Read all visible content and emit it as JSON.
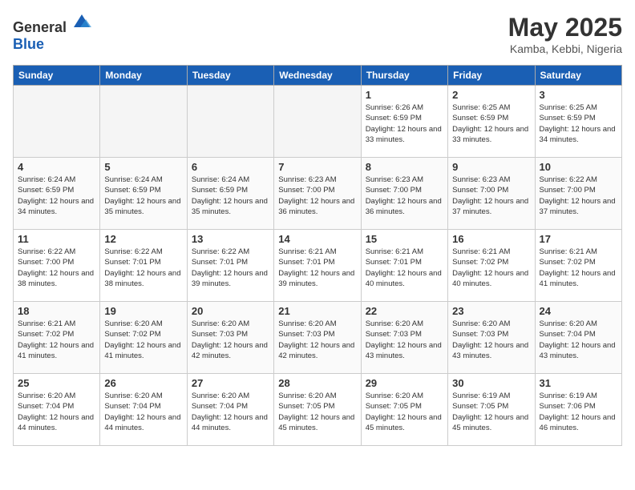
{
  "header": {
    "logo_general": "General",
    "logo_blue": "Blue",
    "title": "May 2025",
    "location": "Kamba, Kebbi, Nigeria"
  },
  "days_of_week": [
    "Sunday",
    "Monday",
    "Tuesday",
    "Wednesday",
    "Thursday",
    "Friday",
    "Saturday"
  ],
  "weeks": [
    [
      {
        "day": "",
        "empty": true
      },
      {
        "day": "",
        "empty": true
      },
      {
        "day": "",
        "empty": true
      },
      {
        "day": "",
        "empty": true
      },
      {
        "day": "1",
        "sunrise": "6:26 AM",
        "sunset": "6:59 PM",
        "daylight": "12 hours and 33 minutes."
      },
      {
        "day": "2",
        "sunrise": "6:25 AM",
        "sunset": "6:59 PM",
        "daylight": "12 hours and 33 minutes."
      },
      {
        "day": "3",
        "sunrise": "6:25 AM",
        "sunset": "6:59 PM",
        "daylight": "12 hours and 34 minutes."
      }
    ],
    [
      {
        "day": "4",
        "sunrise": "6:24 AM",
        "sunset": "6:59 PM",
        "daylight": "12 hours and 34 minutes."
      },
      {
        "day": "5",
        "sunrise": "6:24 AM",
        "sunset": "6:59 PM",
        "daylight": "12 hours and 35 minutes."
      },
      {
        "day": "6",
        "sunrise": "6:24 AM",
        "sunset": "6:59 PM",
        "daylight": "12 hours and 35 minutes."
      },
      {
        "day": "7",
        "sunrise": "6:23 AM",
        "sunset": "7:00 PM",
        "daylight": "12 hours and 36 minutes."
      },
      {
        "day": "8",
        "sunrise": "6:23 AM",
        "sunset": "7:00 PM",
        "daylight": "12 hours and 36 minutes."
      },
      {
        "day": "9",
        "sunrise": "6:23 AM",
        "sunset": "7:00 PM",
        "daylight": "12 hours and 37 minutes."
      },
      {
        "day": "10",
        "sunrise": "6:22 AM",
        "sunset": "7:00 PM",
        "daylight": "12 hours and 37 minutes."
      }
    ],
    [
      {
        "day": "11",
        "sunrise": "6:22 AM",
        "sunset": "7:00 PM",
        "daylight": "12 hours and 38 minutes."
      },
      {
        "day": "12",
        "sunrise": "6:22 AM",
        "sunset": "7:01 PM",
        "daylight": "12 hours and 38 minutes."
      },
      {
        "day": "13",
        "sunrise": "6:22 AM",
        "sunset": "7:01 PM",
        "daylight": "12 hours and 39 minutes."
      },
      {
        "day": "14",
        "sunrise": "6:21 AM",
        "sunset": "7:01 PM",
        "daylight": "12 hours and 39 minutes."
      },
      {
        "day": "15",
        "sunrise": "6:21 AM",
        "sunset": "7:01 PM",
        "daylight": "12 hours and 40 minutes."
      },
      {
        "day": "16",
        "sunrise": "6:21 AM",
        "sunset": "7:02 PM",
        "daylight": "12 hours and 40 minutes."
      },
      {
        "day": "17",
        "sunrise": "6:21 AM",
        "sunset": "7:02 PM",
        "daylight": "12 hours and 41 minutes."
      }
    ],
    [
      {
        "day": "18",
        "sunrise": "6:21 AM",
        "sunset": "7:02 PM",
        "daylight": "12 hours and 41 minutes."
      },
      {
        "day": "19",
        "sunrise": "6:20 AM",
        "sunset": "7:02 PM",
        "daylight": "12 hours and 41 minutes."
      },
      {
        "day": "20",
        "sunrise": "6:20 AM",
        "sunset": "7:03 PM",
        "daylight": "12 hours and 42 minutes."
      },
      {
        "day": "21",
        "sunrise": "6:20 AM",
        "sunset": "7:03 PM",
        "daylight": "12 hours and 42 minutes."
      },
      {
        "day": "22",
        "sunrise": "6:20 AM",
        "sunset": "7:03 PM",
        "daylight": "12 hours and 43 minutes."
      },
      {
        "day": "23",
        "sunrise": "6:20 AM",
        "sunset": "7:03 PM",
        "daylight": "12 hours and 43 minutes."
      },
      {
        "day": "24",
        "sunrise": "6:20 AM",
        "sunset": "7:04 PM",
        "daylight": "12 hours and 43 minutes."
      }
    ],
    [
      {
        "day": "25",
        "sunrise": "6:20 AM",
        "sunset": "7:04 PM",
        "daylight": "12 hours and 44 minutes."
      },
      {
        "day": "26",
        "sunrise": "6:20 AM",
        "sunset": "7:04 PM",
        "daylight": "12 hours and 44 minutes."
      },
      {
        "day": "27",
        "sunrise": "6:20 AM",
        "sunset": "7:04 PM",
        "daylight": "12 hours and 44 minutes."
      },
      {
        "day": "28",
        "sunrise": "6:20 AM",
        "sunset": "7:05 PM",
        "daylight": "12 hours and 45 minutes."
      },
      {
        "day": "29",
        "sunrise": "6:20 AM",
        "sunset": "7:05 PM",
        "daylight": "12 hours and 45 minutes."
      },
      {
        "day": "30",
        "sunrise": "6:19 AM",
        "sunset": "7:05 PM",
        "daylight": "12 hours and 45 minutes."
      },
      {
        "day": "31",
        "sunrise": "6:19 AM",
        "sunset": "7:06 PM",
        "daylight": "12 hours and 46 minutes."
      }
    ]
  ]
}
